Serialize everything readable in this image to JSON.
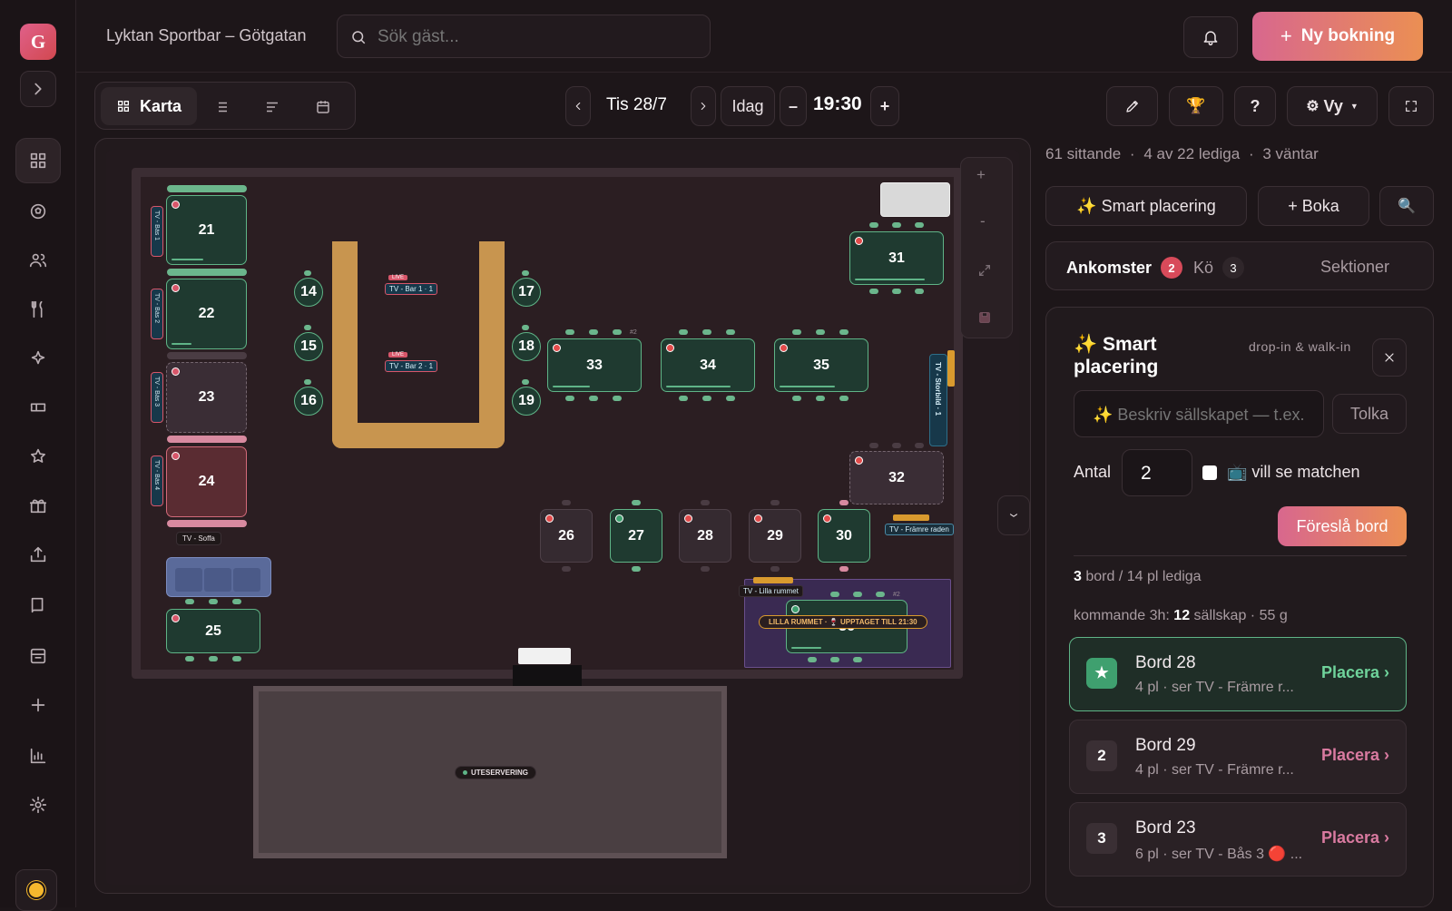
{
  "app": {
    "avatar_letter": "G",
    "venue": "Lyktan Sportbar – Götgatan",
    "search_placeholder": "Sök gäst...",
    "new_booking": "Ny bokning"
  },
  "viewbar": {
    "map_label": "Karta",
    "date": "Tis 28/7",
    "today": "Idag",
    "minus": "–",
    "time": "19:30",
    "plus": "+",
    "view_label": "Vy",
    "help": "?"
  },
  "map": {
    "zoom_in": "+",
    "zoom_out": "-",
    "tables": {
      "t21": "21",
      "t22": "22",
      "t23": "23",
      "t24": "24",
      "t25": "25",
      "t26": "26",
      "t27": "27",
      "t28": "28",
      "t29": "29",
      "t30": "30",
      "t31": "31",
      "t32": "32",
      "t33": "33",
      "t34": "34",
      "t35": "35",
      "t36": "36",
      "t14": "14",
      "t15": "15",
      "t16": "16",
      "t17": "17",
      "t18": "18",
      "t19": "19"
    },
    "tv_bas1": "TV - Bås 1",
    "tv_bas2": "TV - Bås 2",
    "tv_bas3": "TV - Bås 3",
    "tv_bas4": "TV - Bås 4",
    "tv_soffa": "TV - Soffa",
    "tv_bar1": "TV - Bar 1 · 1",
    "tv_bar2": "TV - Bar 2 · 1",
    "live": "LIVE",
    "tv_storbild": "TV - Storbild · 1",
    "tv_framre": "TV - Främre raden",
    "tv_lilla": "TV - Lilla rummet",
    "lilla_banner": "LILLA RUMMET · 🍷 UPPTAGET TILL 21:30",
    "uteservering": "UTESERVERING",
    "tag_2": "#2"
  },
  "right": {
    "stats": {
      "seated": "61 sittande",
      "free": "4 av 22 lediga",
      "waiting": "3 väntar",
      "sep": "·"
    },
    "smart_btn": "✨ Smart placering",
    "book_btn": "+ Boka",
    "tabs": {
      "arrivals": "Ankomster",
      "arrivals_count": "2",
      "queue": "Kö",
      "queue_count": "3",
      "sections": "Sektioner"
    },
    "panel": {
      "title": "✨ Smart placering",
      "subtitle": "drop-in & walk-in",
      "describe_placeholder": "✨ Beskriv sällskapet — t.ex.",
      "interpret": "Tolka",
      "count_label": "Antal",
      "count_value": "2",
      "watch_label": "📺 vill se matchen",
      "suggest": "Föreslå bord",
      "free_count": "3",
      "free_text": "bord / 14 pl lediga",
      "upcoming_prefix": "kommande 3h:",
      "upcoming_count": "12",
      "upcoming_suffix": "sällskap · 55 g"
    },
    "suggestions": [
      {
        "rank": "★",
        "name": "Bord 28",
        "sub": "4 pl · ser TV - Främre r...",
        "action": "Placera ›"
      },
      {
        "rank": "2",
        "name": "Bord 29",
        "sub": "4 pl · ser TV - Främre r...",
        "action": "Placera ›"
      },
      {
        "rank": "3",
        "name": "Bord 23",
        "sub": "6 pl · ser TV - Bås 3 🔴 ...",
        "action": "Placera ›"
      }
    ]
  },
  "colors": {
    "accent_green": "#5fb487",
    "accent_pink": "#d8678e",
    "accent_orange": "#eb8f53",
    "bar_wood": "#c8954f"
  }
}
